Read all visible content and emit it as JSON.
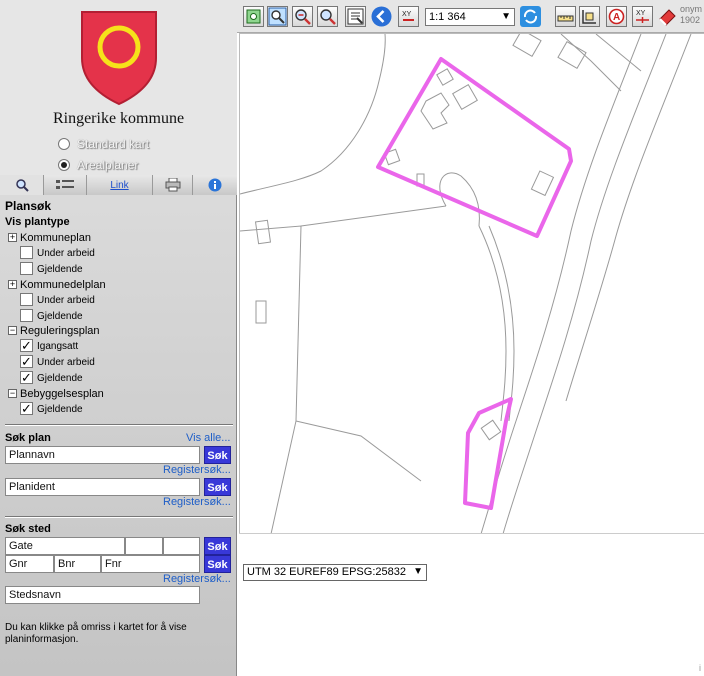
{
  "header": {
    "municipality": "Ringerike kommune",
    "map_options": [
      {
        "label": "Standard kart",
        "selected": false
      },
      {
        "label": "Arealplaner",
        "selected": true
      }
    ]
  },
  "tabs": [
    {
      "icon": "search-icon",
      "active": true
    },
    {
      "icon": "legend-icon",
      "active": false
    },
    {
      "label": "Link",
      "active": false
    },
    {
      "icon": "printer-icon",
      "active": false
    },
    {
      "icon": "info-icon",
      "active": false
    }
  ],
  "plansok": {
    "title": "Plansøk",
    "vis_plantype": "Vis plantype",
    "groups": [
      {
        "label": "Kommuneplan",
        "toggle": "+",
        "items": [
          {
            "label": "Under arbeid",
            "checked": false
          },
          {
            "label": "Gjeldende",
            "checked": false
          }
        ]
      },
      {
        "label": "Kommunedelplan",
        "toggle": "+",
        "items": [
          {
            "label": "Under arbeid",
            "checked": false
          },
          {
            "label": "Gjeldende",
            "checked": false
          }
        ]
      },
      {
        "label": "Reguleringsplan",
        "toggle": "−",
        "items": [
          {
            "label": "Igangsatt",
            "checked": true
          },
          {
            "label": "Under arbeid",
            "checked": true
          },
          {
            "label": "Gjeldende",
            "checked": true
          }
        ]
      },
      {
        "label": "Bebyggelsesplan",
        "toggle": "−",
        "items": [
          {
            "label": "Gjeldende",
            "checked": true
          }
        ]
      }
    ],
    "sok_plan": "Søk plan",
    "vis_alle": "Vis alle...",
    "plannavn": "Plannavn",
    "planident": "Planident",
    "sok_button": "Søk",
    "registersok": "Registersøk...",
    "sok_sted": "Søk sted",
    "gate": "Gate",
    "gnr": "Gnr",
    "bnr": "Bnr",
    "fnr": "Fnr",
    "stedsnavn": "Stedsnavn",
    "help": "Du kan klikke på omriss i kartet for å vise planinformasjon."
  },
  "toolbar": {
    "scale": "1:1 364",
    "coord_line1": "onym",
    "coord_line2": "1902",
    "tools": [
      "zoom-extent-icon",
      "zoom-area-icon",
      "zoom-in-icon",
      "zoom-out-icon",
      "pan-icon",
      "back-icon",
      "goto-xy-icon",
      "refresh-icon",
      "measure-icon",
      "measure-area-icon",
      "text-label-icon",
      "coordinate-icon",
      "eraser-icon"
    ]
  },
  "bottom": {
    "crs": "UTM 32 EUREF89 EPSG:25832",
    "status": "i"
  },
  "colors": {
    "accent_button": "#3838d8",
    "plan_outline": "#ea66ea",
    "shield_red": "#e4334a",
    "shield_ring": "#f6e21a"
  }
}
